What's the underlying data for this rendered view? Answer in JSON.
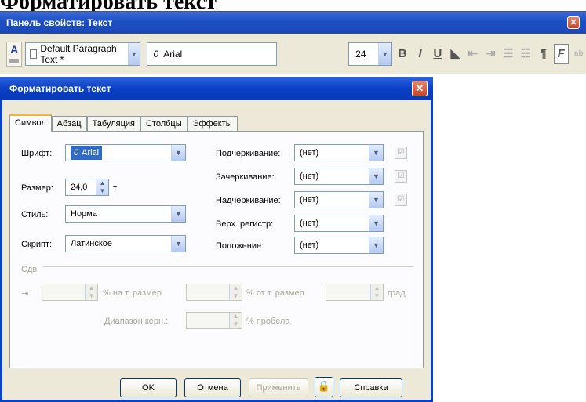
{
  "page": {
    "caption": "Форматировать текст"
  },
  "propbar": {
    "title": "Панель свойств: Текст",
    "paragraph_style": "Default Paragraph Text *",
    "font_icon": "0",
    "font_name": "Arial",
    "font_size": "24",
    "format_glyphs": [
      "B",
      "I",
      "U",
      "◣",
      "⇤",
      "⇥",
      "☰",
      "☷",
      "¶",
      "F",
      "ab"
    ]
  },
  "dialog": {
    "title": "Форматировать текст",
    "tabs": [
      "Символ",
      "Абзац",
      "Табуляция",
      "Столбцы",
      "Эффекты"
    ],
    "active_tab": "Символ",
    "font_label": "Шрифт:",
    "font_value": "Arial",
    "size_label": "Размер:",
    "size_value": "24,0",
    "size_unit": "т",
    "style_label": "Стиль:",
    "style_value": "Норма",
    "script_label": "Скрипт:",
    "script_value": "Латинское",
    "underline_label": "Подчеркивание:",
    "underline_value": "(нет)",
    "strike_label": "Зачеркивание:",
    "strike_value": "(нет)",
    "overline_label": "Надчеркивание:",
    "overline_value": "(нет)",
    "case_label": "Верх. регистр:",
    "case_value": "(нет)",
    "position_label": "Положение:",
    "position_value": "(нет)",
    "shift_group": "Сдв",
    "shift_x_unit": "% на т. размер",
    "shift_y_unit": "% от т. размер",
    "shift_angle_unit": "град.",
    "kerning_label": "Диапазон керн.:",
    "kerning_unit": "% пробела",
    "buttons": {
      "ok": "OK",
      "cancel": "Отмена",
      "apply": "Применить",
      "help": "Справка"
    }
  }
}
